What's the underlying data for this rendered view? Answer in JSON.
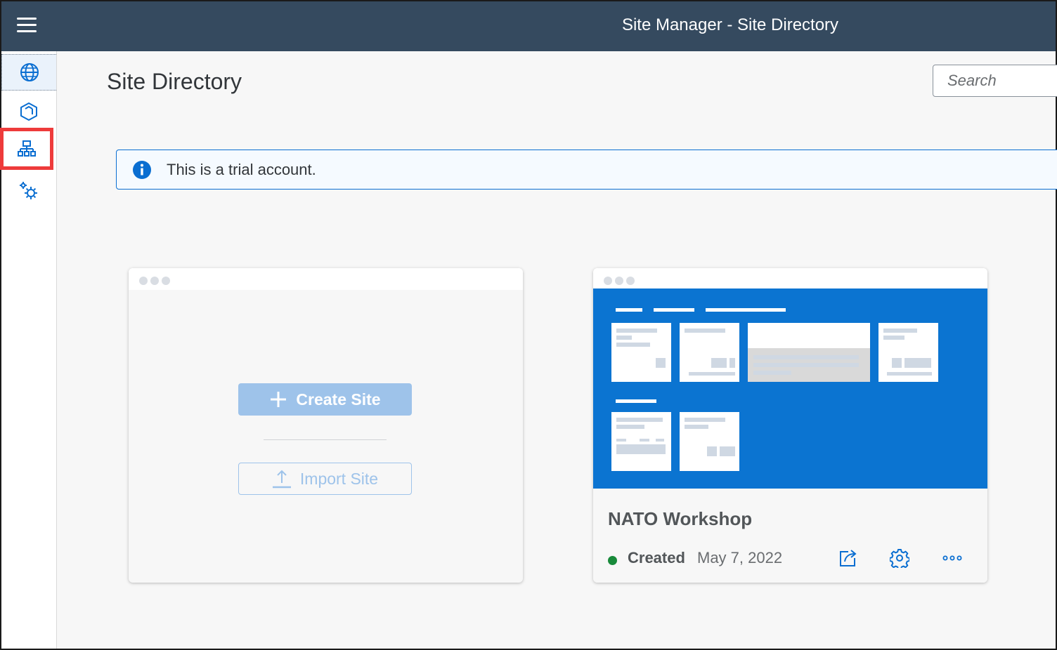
{
  "shellbar": {
    "title": "Site Manager - Site Directory"
  },
  "sidenav": {
    "items": [
      {
        "icon": "globe-icon",
        "selected": true
      },
      {
        "icon": "cube-icon",
        "selected": false
      },
      {
        "icon": "org-chart-icon",
        "selected": false,
        "highlighted": true
      },
      {
        "icon": "settings-gears-icon",
        "selected": false
      }
    ]
  },
  "page": {
    "title": "Site Directory",
    "search_placeholder": "Search"
  },
  "info": {
    "text": "This is a trial account."
  },
  "new_site_card": {
    "create_label": "Create Site",
    "import_label": "Import Site"
  },
  "site_card": {
    "name": "NATO Workshop",
    "status": "Created",
    "date": "May 7, 2022",
    "status_color": "#188a3a"
  },
  "colors": {
    "shellbar": "#354a5f",
    "accent": "#0a6ed1",
    "preview": "#0b74d1"
  }
}
